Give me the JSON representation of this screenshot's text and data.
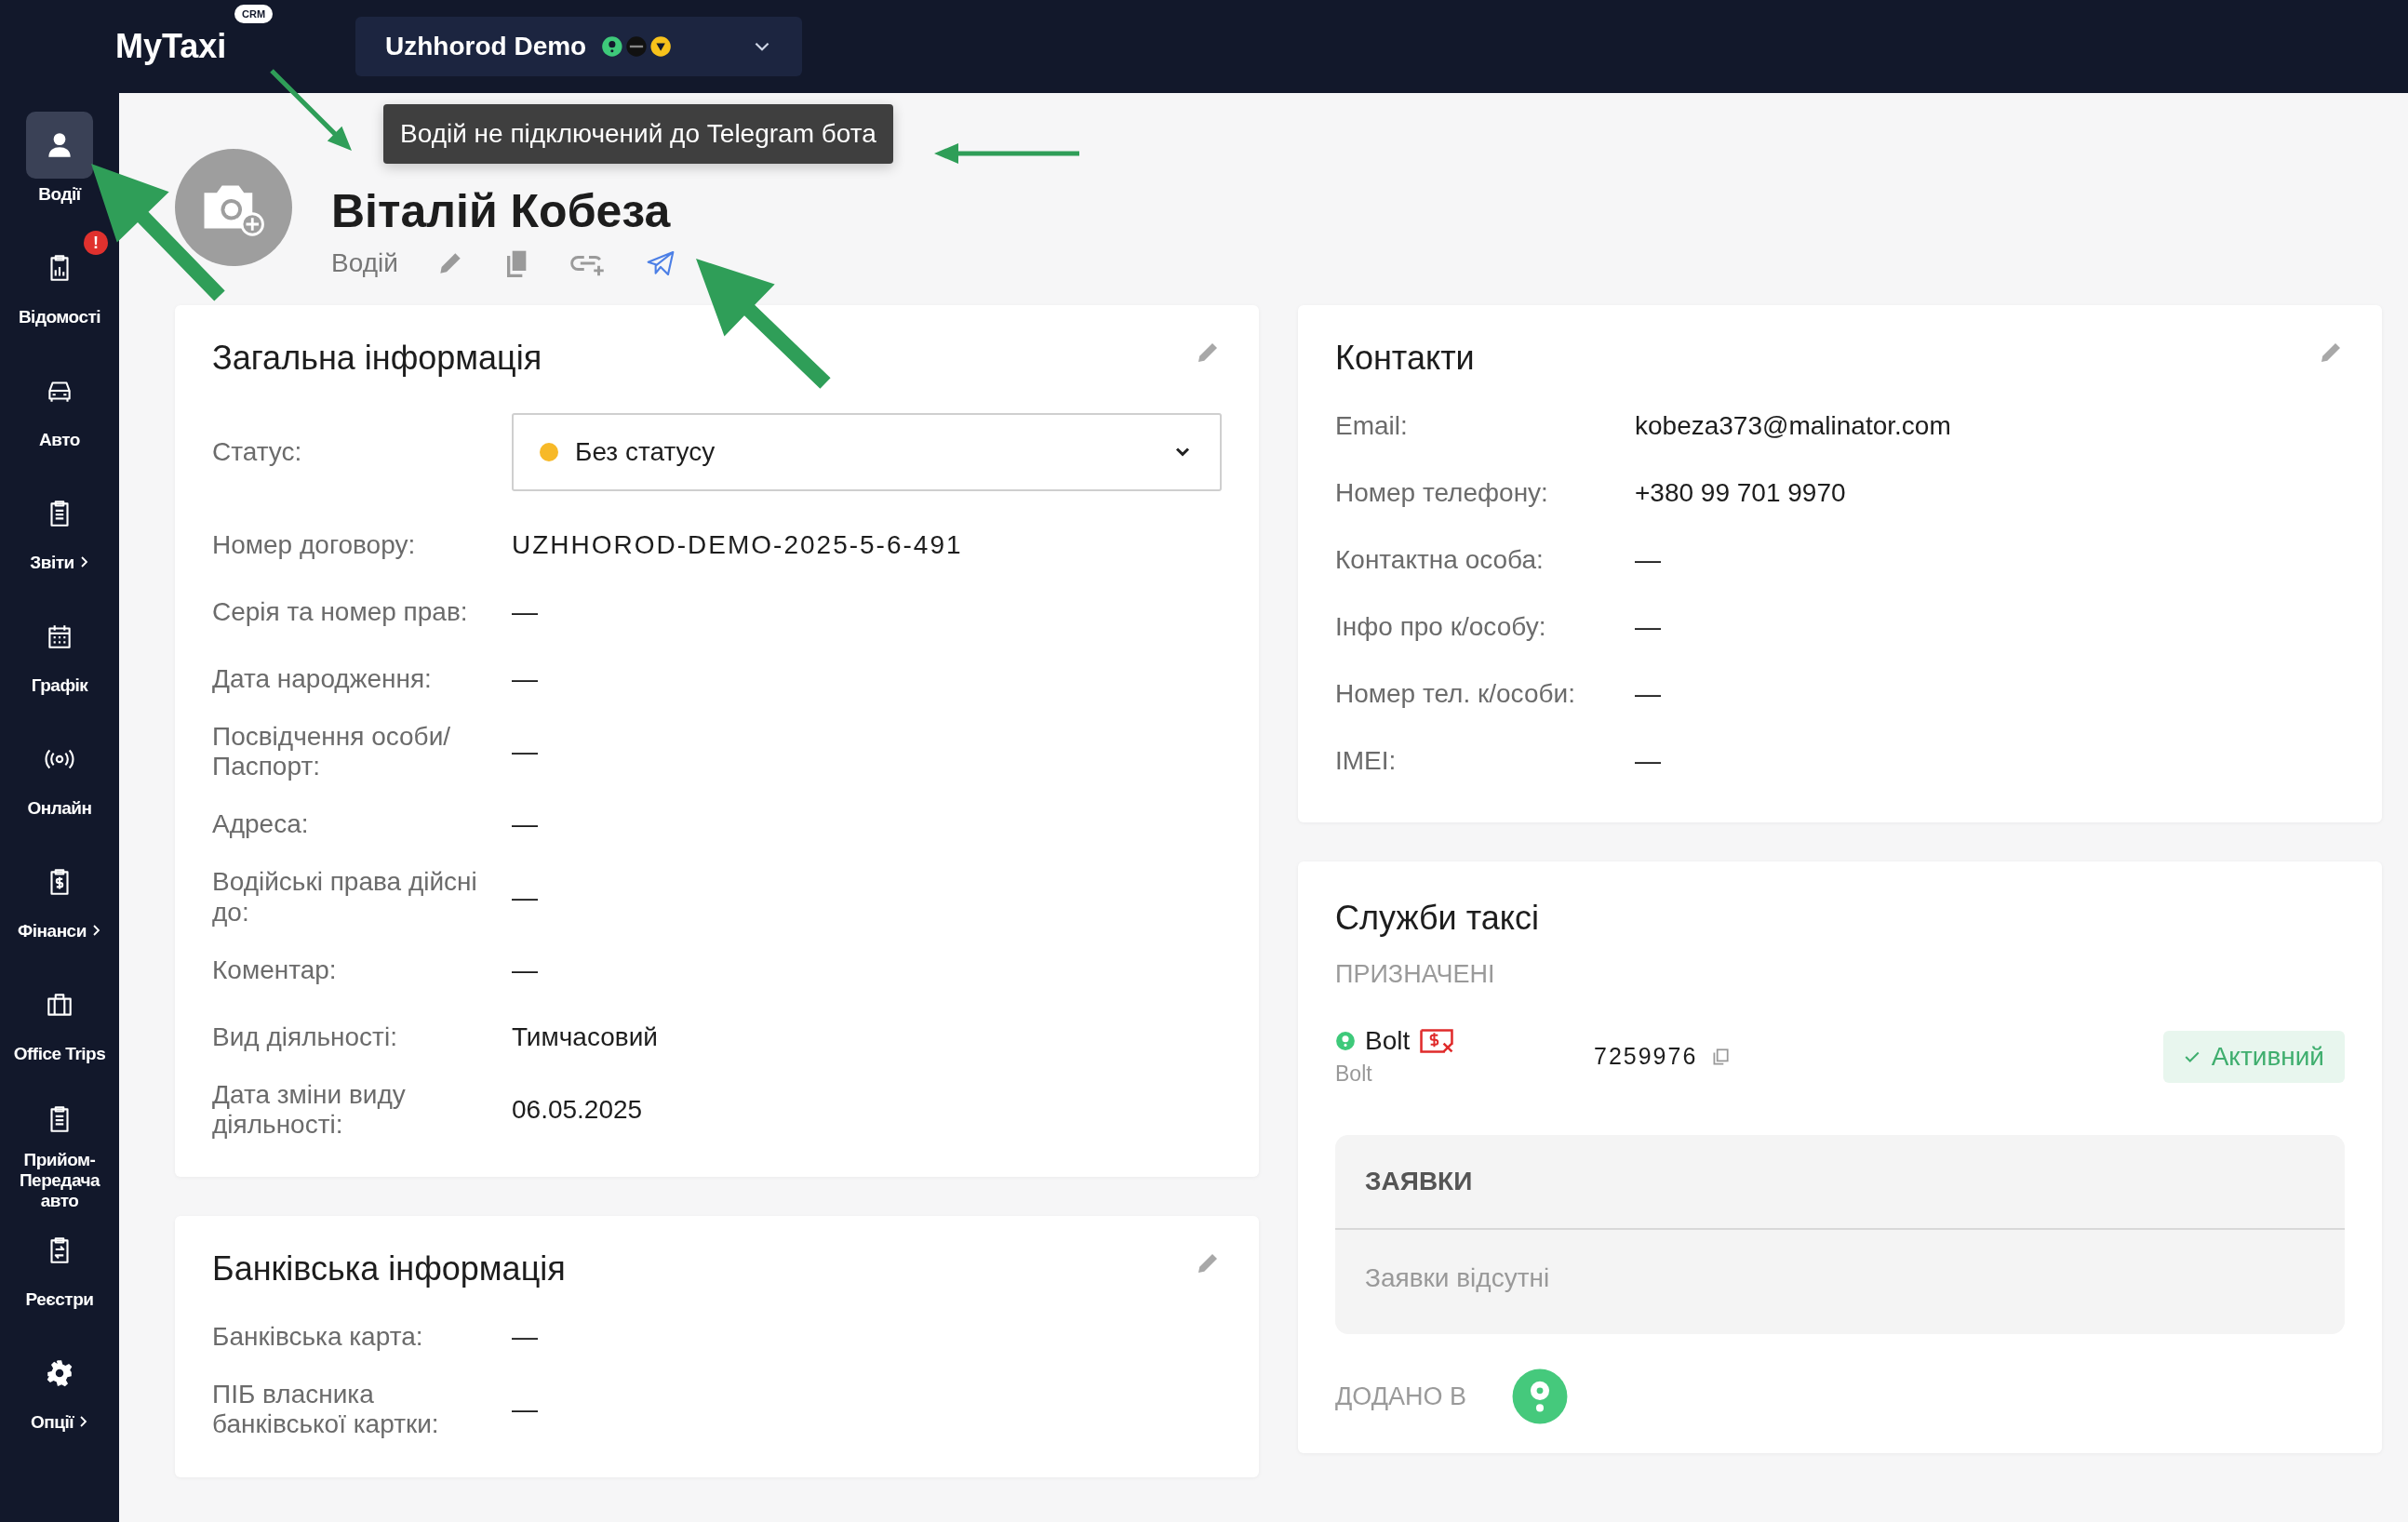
{
  "topbar": {
    "logo": "MyTaxi",
    "logo_badge": "CRM",
    "city_selector": "Uzhhorod Demo"
  },
  "sidebar": {
    "items": [
      {
        "label": "Водії",
        "selected": true,
        "submenu": false
      },
      {
        "label": "Відомості",
        "selected": false,
        "submenu": false,
        "badge": "!"
      },
      {
        "label": "Авто",
        "selected": false,
        "submenu": false
      },
      {
        "label": "Звіти",
        "selected": false,
        "submenu": true
      },
      {
        "label": "Графік",
        "selected": false,
        "submenu": false
      },
      {
        "label": "Онлайн",
        "selected": false,
        "submenu": false
      },
      {
        "label": "Фінанси",
        "selected": false,
        "submenu": true
      },
      {
        "label": "Office Trips",
        "selected": false,
        "submenu": false
      },
      {
        "label": "Прийом-Передача авто",
        "selected": false,
        "submenu": false
      },
      {
        "label": "Реєстри",
        "selected": false,
        "submenu": false
      },
      {
        "label": "Опції",
        "selected": false,
        "submenu": true
      }
    ]
  },
  "driver": {
    "name": "Віталій Кобеза",
    "role": "Водій",
    "tooltip": "Водій не підключений до Telegram бота"
  },
  "general_info": {
    "title": "Загальна інформація",
    "status": {
      "label": "Статус:",
      "value": "Без статусу",
      "color": "#f7b928"
    },
    "fields": [
      {
        "label": "Номер договору:",
        "value": "UZHHOROD-DEMO-2025-5-6-491",
        "kind": "code"
      },
      {
        "label": "Серія та номер прав:",
        "value": "—",
        "kind": "text"
      },
      {
        "label": "Дата народження:",
        "value": "—",
        "kind": "text"
      },
      {
        "label": "Посвідчення особи/ Паспорт:",
        "value": "—",
        "kind": "text"
      },
      {
        "label": "Адреса:",
        "value": "—",
        "kind": "text"
      },
      {
        "label": "Водійські права дійсні до:",
        "value": "—",
        "kind": "text"
      },
      {
        "label": "Коментар:",
        "value": "—",
        "kind": "text"
      },
      {
        "label": "Вид діяльності:",
        "value": "Тимчасовий",
        "kind": "text"
      },
      {
        "label": "Дата зміни виду діяльності:",
        "value": "06.05.2025",
        "kind": "text"
      }
    ]
  },
  "bank_info": {
    "title": "Банківська інформація",
    "fields": [
      {
        "label": "Банківська карта:",
        "value": "—"
      },
      {
        "label": "ПІБ власника банківської картки:",
        "value": "—"
      }
    ]
  },
  "contacts": {
    "title": "Контакти",
    "fields": [
      {
        "label": "Email:",
        "value": "kobeza373@malinator.com"
      },
      {
        "label": "Номер телефону:",
        "value": "+380 99 701 9970"
      },
      {
        "label": "Контактна особа:",
        "value": "—"
      },
      {
        "label": "Інфо про к/особу:",
        "value": "—"
      },
      {
        "label": "Номер тел. к/особи:",
        "value": "—"
      },
      {
        "label": "IMEI:",
        "value": "—"
      }
    ]
  },
  "taxi_services": {
    "title": "Служби таксі",
    "assigned_heading": "ПРИЗНАЧЕНІ",
    "services": [
      {
        "name": "Bolt",
        "subtitle": "Bolt",
        "id": "7259976",
        "status": "Активний",
        "active": true
      }
    ],
    "requests": {
      "heading": "ЗАЯВКИ",
      "empty_text": "Заявки відсутні"
    },
    "added_in_heading": "ДОДАНО В"
  }
}
